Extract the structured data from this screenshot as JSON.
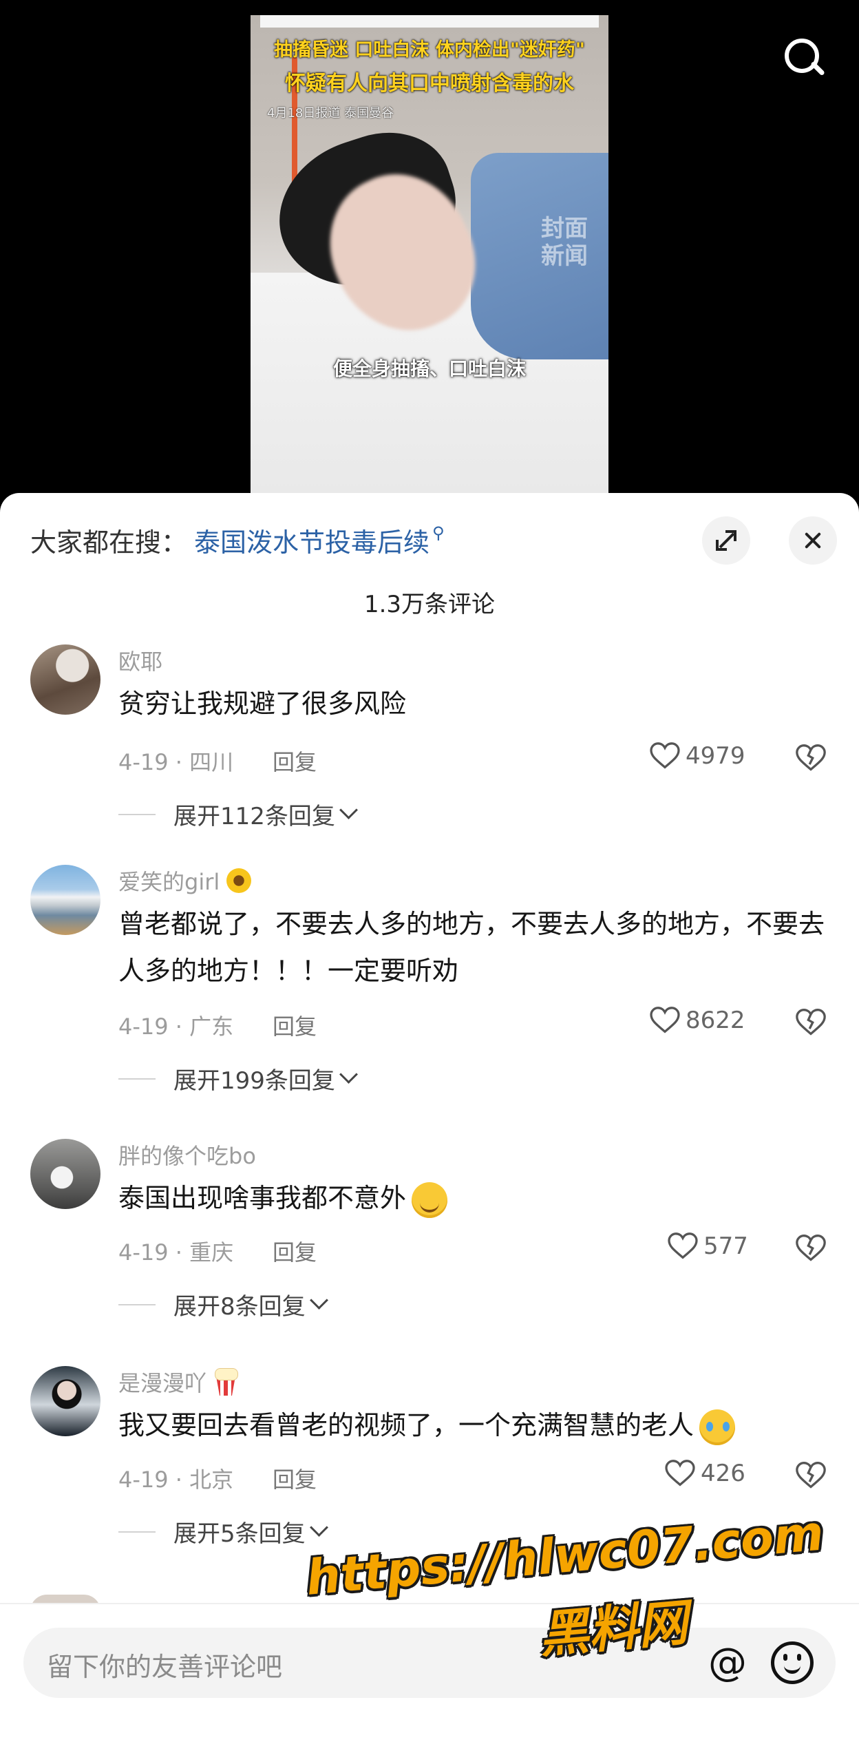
{
  "video": {
    "headline_line1": "抽搐昏迷 口吐白沫 体内检出\"迷奸药\"",
    "headline_line2": "怀疑有人向其口中喷射含毒的水",
    "report_date": "4月18日报道 泰国曼谷",
    "subtitle": "便全身抽搐、口吐白沫",
    "watermark": "封面新闻"
  },
  "header": {
    "hot_search_label": "大家都在搜：",
    "hot_search_term": "泰国泼水节投毒后续",
    "comment_count": "1.3万条评论"
  },
  "comments": [
    {
      "user": "欧耶",
      "text": "贫穷让我规避了很多风险",
      "meta": "4-19 · 四川",
      "reply": "回复",
      "likes": "4979",
      "expand": "展开112条回复"
    },
    {
      "user": "爱笑的girl",
      "user_emoji": "sunflower-emoji",
      "text": "曾老都说了，不要去人多的地方，不要去人多的地方，不要去人多的地方！！！一定要听劝",
      "meta": "4-19 · 广东",
      "reply": "回复",
      "likes": "8622",
      "expand": "展开199条回复"
    },
    {
      "user": "胖的像个吃bo",
      "text": "泰国出现啥事我都不意外",
      "text_emoji": "grin-emoji",
      "meta": "4-19 · 重庆",
      "reply": "回复",
      "likes": "577",
      "expand": "展开8条回复"
    },
    {
      "user": "是漫漫吖",
      "user_emoji": "popcorn-emoji",
      "text": "我又要回去看曾老的视频了，一个充满智慧的老人",
      "text_emoji": "teary-eyed-emoji",
      "meta": "4-19 · 北京",
      "reply": "回复",
      "likes": "426",
      "expand": "展开5条回复"
    }
  ],
  "input": {
    "placeholder": "留下你的友善评论吧",
    "at_symbol": "@"
  },
  "promo_overlay": {
    "url": "https://hlwc07.com",
    "name": "黑料网"
  },
  "colors": {
    "link_blue": "#2c62a6",
    "promo_orange": "#f5a400",
    "headline_yellow": "#ffd21e"
  }
}
